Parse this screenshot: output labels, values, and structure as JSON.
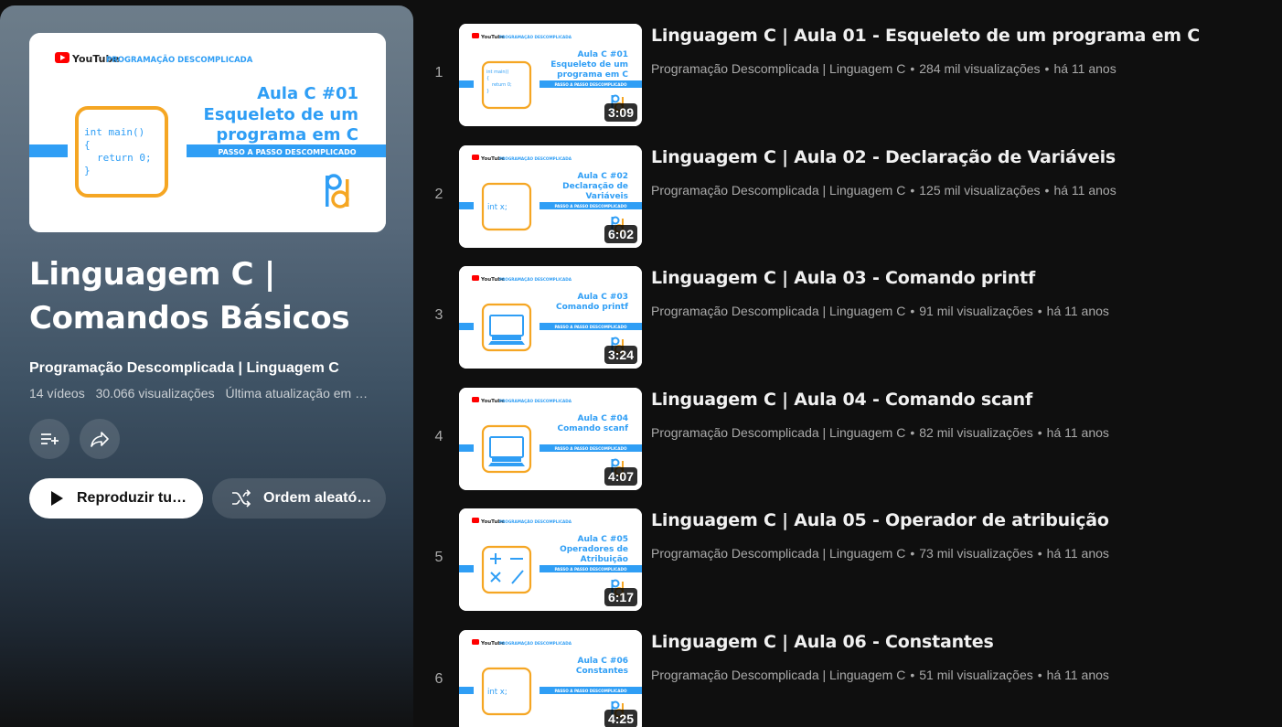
{
  "playlist": {
    "title": "Linguagem C | Comandos Básicos",
    "channel": "Programação Descomplicada | Linguagem C",
    "video_count": "14 vídeos",
    "views": "30.066 visualizações",
    "updated": "Última atualização em …",
    "play_all_label": "Reproduzir tu…",
    "shuffle_label": "Ordem aleató…",
    "hero": {
      "brand": "YouTube",
      "series": "PROGRAMAÇÃO DESCOMPLICADA",
      "lesson": "Aula C #01",
      "topic_line1": "Esqueleto de um",
      "topic_line2": "programa em C",
      "banner": "PASSO A PASSO DESCOMPLICADO",
      "code_line1": "int main()",
      "code_line2": "{",
      "code_line3": "return 0;",
      "code_line4": "}"
    }
  },
  "thumb_common": {
    "brand": "YouTube",
    "series": "PROGRAMAÇÃO DESCOMPLICADA",
    "banner": "PASSO A PASSO DESCOMPLICADO"
  },
  "videos": [
    {
      "index": "1",
      "title": "Linguagem C | Aula 01 - Esqueleto de um programa em C",
      "channel": "Programação Descomplicada | Linguagem C",
      "views": "284 mil visualizações",
      "age": "há 11 anos",
      "duration": "3:09",
      "thumb_lesson": "Aula C #01",
      "thumb_topic1": "Esqueleto de um",
      "thumb_topic2": "programa em C",
      "thumb_icon": "code",
      "code1": "int main()",
      "code2": "{",
      "code3": "return 0;",
      "code4": "}"
    },
    {
      "index": "2",
      "title": "Linguagem C | Aula 02 - Declaração de Variáveis",
      "channel": "Programação Descomplicada | Linguagem C",
      "views": "125 mil visualizações",
      "age": "há 11 anos",
      "duration": "6:02",
      "thumb_lesson": "Aula C #02",
      "thumb_topic1": "Declaração de",
      "thumb_topic2": "Variáveis",
      "thumb_icon": "var",
      "code1": "int x;"
    },
    {
      "index": "3",
      "title": "Linguagem C | Aula 03 - Comando printf",
      "channel": "Programação Descomplicada | Linguagem C",
      "views": "91 mil visualizações",
      "age": "há 11 anos",
      "duration": "3:24",
      "thumb_lesson": "Aula C #03",
      "thumb_topic1": "Comando printf",
      "thumb_topic2": "",
      "thumb_icon": "monitor"
    },
    {
      "index": "4",
      "title": "Linguagem C | Aula 04 - Comando scanf",
      "channel": "Programação Descomplicada | Linguagem C",
      "views": "82 mil visualizações",
      "age": "há 11 anos",
      "duration": "4:07",
      "thumb_lesson": "Aula C #04",
      "thumb_topic1": "Comando scanf",
      "thumb_topic2": "",
      "thumb_icon": "monitor"
    },
    {
      "index": "5",
      "title": "Linguagem C | Aula 05 - Operador de atribuição",
      "channel": "Programação Descomplicada | Linguagem C",
      "views": "73 mil visualizações",
      "age": "há 11 anos",
      "duration": "6:17",
      "thumb_lesson": "Aula C #05",
      "thumb_topic1": "Operadores de",
      "thumb_topic2": "Atribuição",
      "thumb_icon": "math"
    },
    {
      "index": "6",
      "title": "Linguagem C | Aula 06 - Constantes",
      "channel": "Programação Descomplicada | Linguagem C",
      "views": "51 mil visualizações",
      "age": "há 11 anos",
      "duration": "4:25",
      "thumb_lesson": "Aula C #06",
      "thumb_topic1": "Constantes",
      "thumb_topic2": "",
      "thumb_icon": "var",
      "code1": "int x;"
    }
  ],
  "colors": {
    "accent_blue": "#2f9ef5",
    "accent_orange": "#f5a623",
    "youtube_red": "#ff0000"
  }
}
